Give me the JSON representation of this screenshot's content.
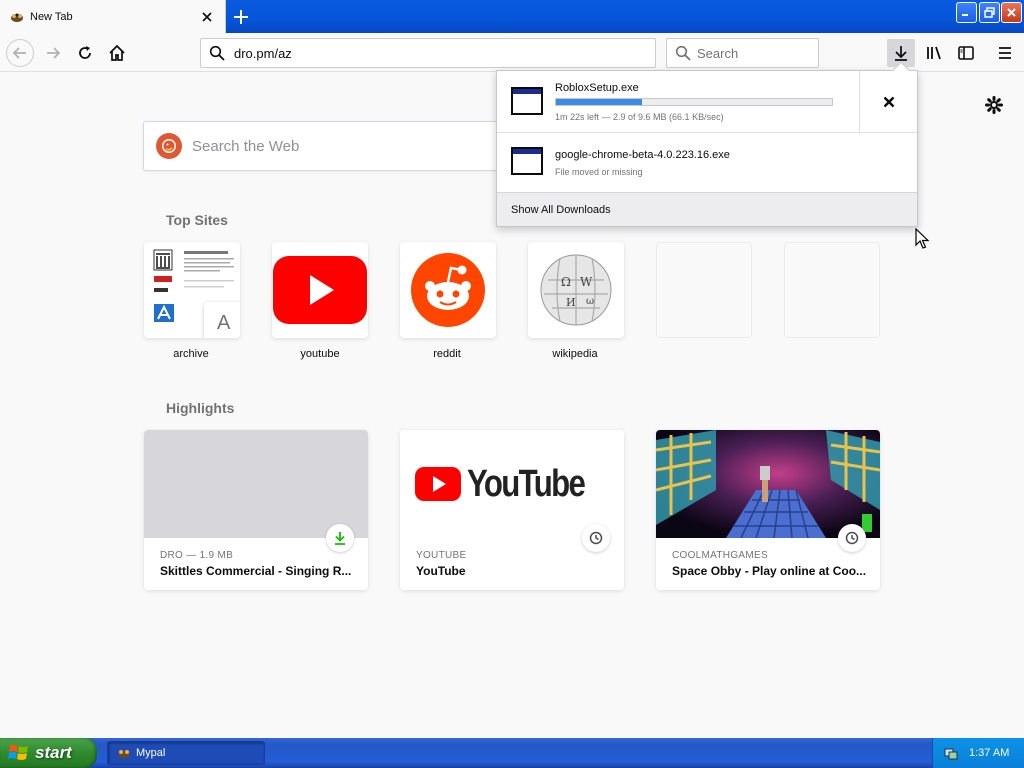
{
  "tab": {
    "title": "New Tab"
  },
  "nav": {
    "url": "dro.pm/az",
    "search_placeholder": "Search"
  },
  "newtab": {
    "search_placeholder": "Search the Web",
    "top_sites_title": "Top Sites",
    "highlights_title": "Highlights",
    "top_sites": [
      {
        "label": "archive",
        "icon": "archive-thumbnail"
      },
      {
        "label": "youtube",
        "icon": "youtube-logo"
      },
      {
        "label": "reddit",
        "icon": "reddit-logo"
      },
      {
        "label": "wikipedia",
        "icon": "wikipedia-globe"
      },
      {
        "label": "",
        "icon": ""
      },
      {
        "label": "",
        "icon": ""
      }
    ],
    "archive_overlay_letter": "A",
    "highlights": [
      {
        "source": "DRO — 1.9 MB",
        "title": "Skittles Commercial - Singing R...",
        "badge": "download-icon"
      },
      {
        "source": "YOUTUBE",
        "title": "YouTube",
        "badge": "clock-icon"
      },
      {
        "source": "COOLMATHGAMES",
        "title": "Space Obby - Play online at Coo...",
        "badge": "clock-icon"
      }
    ],
    "youtube_wordmark": "YouTube"
  },
  "downloads": {
    "items": [
      {
        "name": "RobloxSetup.exe",
        "status": "1m 22s left — 2.9 of 9.6 MB (66.1 KB/sec)",
        "progress": 0.31
      },
      {
        "name": "google-chrome-beta-4.0.223.16.exe",
        "status": "File moved or missing"
      }
    ],
    "show_all": "Show All Downloads"
  },
  "taskbar": {
    "start": "start",
    "task": "Mypal",
    "clock": "1:37 AM"
  },
  "colors": {
    "accent": "#0a84ff",
    "titlebar": "#0655d8",
    "youtube_red": "#ff0000",
    "reddit_orange": "#ff4500",
    "progress": "#3d8ae6"
  }
}
